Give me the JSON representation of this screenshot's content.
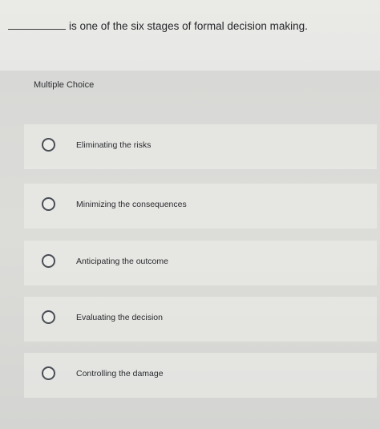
{
  "question": {
    "text": "is one of the six stages of formal decision making."
  },
  "panel": {
    "title": "Multiple Choice"
  },
  "choices": [
    {
      "label": "Eliminating the risks"
    },
    {
      "label": "Minimizing the consequences"
    },
    {
      "label": "Anticipating the outcome"
    },
    {
      "label": "Evaluating the decision"
    },
    {
      "label": "Controlling the damage"
    }
  ]
}
